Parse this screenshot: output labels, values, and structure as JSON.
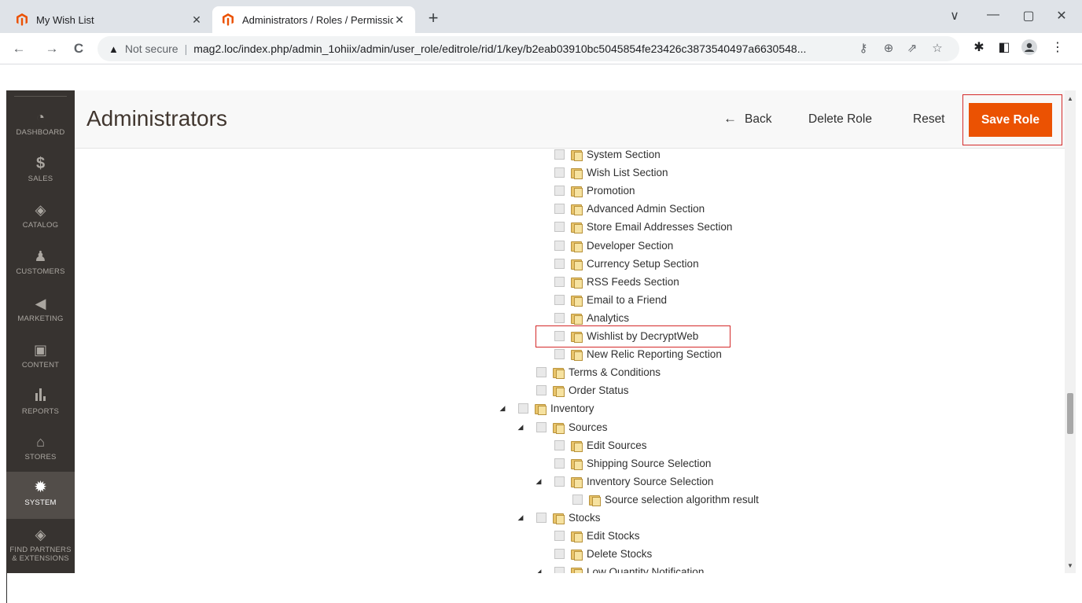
{
  "browser": {
    "tabs": [
      {
        "title": "My Wish List",
        "active": false
      },
      {
        "title": "Administrators / Roles / Permissic",
        "active": true
      }
    ],
    "new_tab": "+",
    "window_controls": {
      "minimize": "—",
      "maximize": "▢",
      "close": "✕",
      "tabsearch": "∨"
    },
    "nav": {
      "back": "←",
      "forward": "→",
      "reload": "C"
    },
    "security_label": "Not secure",
    "url": "mag2.loc/index.php/admin_1ohiix/admin/user_role/editrole/rid/1/key/b2eab03910bc5045854fe23426c3873540497a6630548..."
  },
  "sidebar": {
    "items": [
      {
        "label": "DASHBOARD",
        "icon": "dashboard-icon"
      },
      {
        "label": "SALES",
        "icon": "dollar-icon"
      },
      {
        "label": "CATALOG",
        "icon": "cube-icon"
      },
      {
        "label": "CUSTOMERS",
        "icon": "person-icon"
      },
      {
        "label": "MARKETING",
        "icon": "megaphone-icon"
      },
      {
        "label": "CONTENT",
        "icon": "layout-icon"
      },
      {
        "label": "REPORTS",
        "icon": "bar-chart-icon"
      },
      {
        "label": "STORES",
        "icon": "store-icon"
      },
      {
        "label": "SYSTEM",
        "icon": "gear-icon",
        "active": true
      },
      {
        "label": "FIND PARTNERS",
        "label2": "& EXTENSIONS",
        "icon": "box-icon"
      }
    ]
  },
  "header": {
    "title": "Administrators",
    "back_label": "Back",
    "delete_label": "Delete Role",
    "reset_label": "Reset",
    "save_label": "Save Role"
  },
  "tree": [
    {
      "label": "System Section",
      "level": 3
    },
    {
      "label": "Wish List Section",
      "level": 3
    },
    {
      "label": "Promotion",
      "level": 3
    },
    {
      "label": "Advanced Admin Section",
      "level": 3
    },
    {
      "label": "Store Email Addresses Section",
      "level": 3
    },
    {
      "label": "Developer Section",
      "level": 3
    },
    {
      "label": "Currency Setup Section",
      "level": 3
    },
    {
      "label": "RSS Feeds Section",
      "level": 3
    },
    {
      "label": "Email to a Friend",
      "level": 3
    },
    {
      "label": "Analytics",
      "level": 3
    },
    {
      "label": "Wishlist by DecryptWeb",
      "level": 3,
      "highlighted": true
    },
    {
      "label": "New Relic Reporting Section",
      "level": 3
    },
    {
      "label": "Terms & Conditions",
      "level": 2
    },
    {
      "label": "Order Status",
      "level": 2
    },
    {
      "label": "Inventory",
      "level": 1,
      "expanded": true
    },
    {
      "label": "Sources",
      "level": 2,
      "expanded": true
    },
    {
      "label": "Edit Sources",
      "level": 3
    },
    {
      "label": "Shipping Source Selection",
      "level": 3
    },
    {
      "label": "Inventory Source Selection",
      "level": 3,
      "expanded": true
    },
    {
      "label": "Source selection algorithm result",
      "level": 4
    },
    {
      "label": "Stocks",
      "level": 2,
      "expanded": true
    },
    {
      "label": "Edit Stocks",
      "level": 3
    },
    {
      "label": "Delete Stocks",
      "level": 3
    },
    {
      "label": "Low Quantity Notification",
      "level": 3,
      "expanded": true
    }
  ]
}
